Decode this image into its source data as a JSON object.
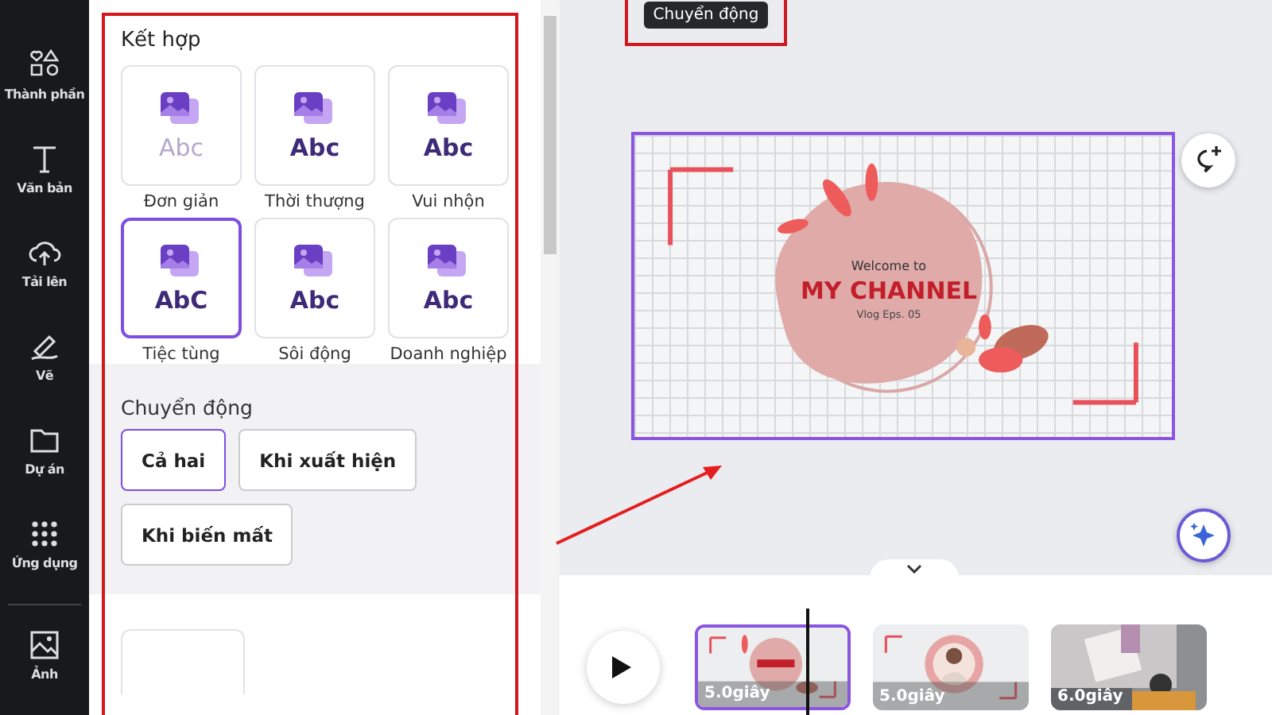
{
  "sidebar": {
    "items": [
      {
        "label": "Thành phần"
      },
      {
        "label": "Văn bản"
      },
      {
        "label": "Tải lên"
      },
      {
        "label": "Vẽ"
      },
      {
        "label": "Dự án"
      },
      {
        "label": "Ứng dụng"
      },
      {
        "label": "Ảnh"
      }
    ]
  },
  "panel": {
    "section_title": "Kết hợp",
    "animations": [
      {
        "label": "Đơn giản",
        "preview": "Abc",
        "selected": false
      },
      {
        "label": "Thời thượng",
        "preview": "Abc",
        "selected": false
      },
      {
        "label": "Vui nhộn",
        "preview": "Abc",
        "selected": false
      },
      {
        "label": "Tiệc tùng",
        "preview": "AbC",
        "selected": true
      },
      {
        "label": "Sôi động",
        "preview": "Abc",
        "selected": false
      },
      {
        "label": "Doanh nghiệp",
        "preview": "Abc",
        "selected": false
      }
    ],
    "motion_title": "Chuyển động",
    "motion_options": [
      {
        "label": "Cả hai",
        "selected": true
      },
      {
        "label": "Khi xuất hiện",
        "selected": false
      },
      {
        "label": "Khi biến mất",
        "selected": false
      }
    ]
  },
  "canvas": {
    "tooltip": "Chuyển động",
    "design": {
      "kicker": "Welcome to",
      "title": "MY CHANNEL",
      "subtitle": "Vlog Eps. 05"
    }
  },
  "timeline": {
    "clips": [
      {
        "duration": "5.0giây",
        "selected": true,
        "kind": "design"
      },
      {
        "duration": "5.0giây",
        "selected": false,
        "kind": "picture"
      },
      {
        "duration": "6.0giây",
        "selected": false,
        "kind": "picture"
      }
    ]
  }
}
